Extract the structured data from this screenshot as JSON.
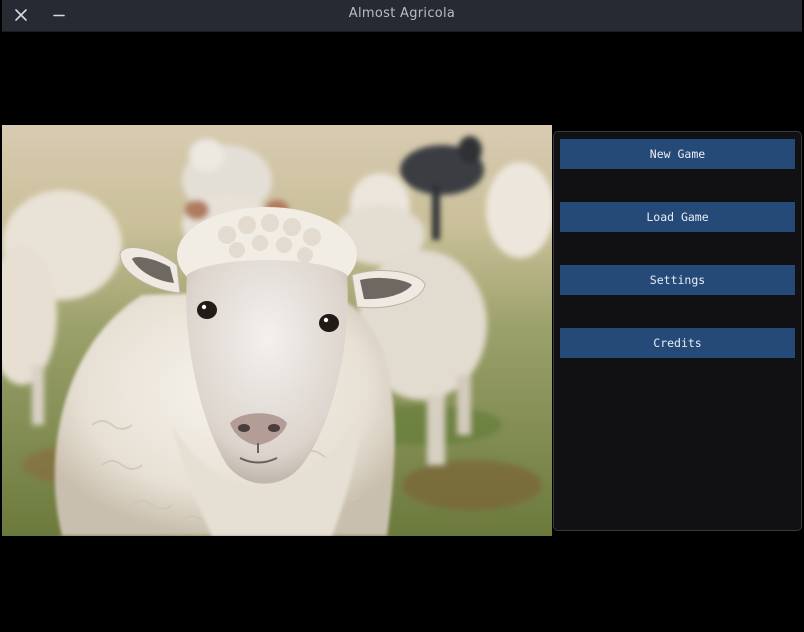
{
  "window": {
    "title": "Almost Agricola",
    "close_icon": "close-icon",
    "minimize_icon": "minimize-icon"
  },
  "splash": {
    "image": "sheep-photo",
    "colors": {
      "grass": "#7d8a4e",
      "wool": "#ece6dc",
      "dark_sheep": "#3b3d42"
    }
  },
  "menu": {
    "new_game": "New Game",
    "load_game": "Load Game",
    "settings": "Settings",
    "credits": "Credits",
    "button_color": "#264a77"
  }
}
